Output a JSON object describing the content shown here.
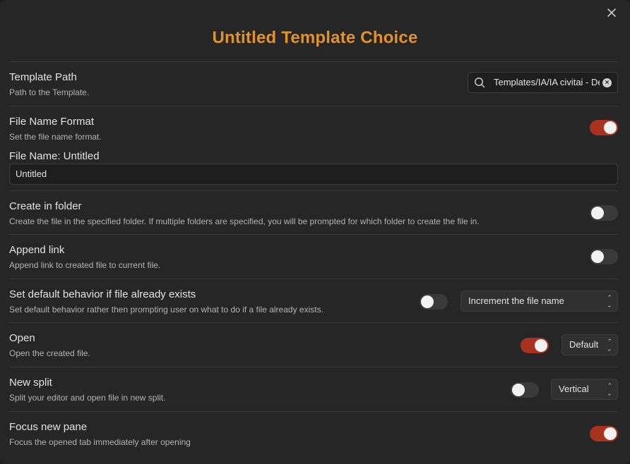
{
  "modal": {
    "title": "Untitled Template Choice",
    "close_icon": "close-icon"
  },
  "template_path": {
    "name": "Template Path",
    "desc": "Path to the Template.",
    "value": "Templates/IA/IA civitai - Default",
    "search_icon": "search-icon",
    "clear_icon": "clear-icon"
  },
  "file_name_format": {
    "name": "File Name Format",
    "desc": "Set the file name format.",
    "enabled": true,
    "label": "File Name: Untitled",
    "value": "Untitled"
  },
  "create_in_folder": {
    "name": "Create in folder",
    "desc": "Create the file in the specified folder. If multiple folders are specified, you will be prompted for which folder to create the file in.",
    "enabled": false
  },
  "append_link": {
    "name": "Append link",
    "desc": "Append link to created file to current file.",
    "enabled": false
  },
  "default_behavior": {
    "name": "Set default behavior if file already exists",
    "desc": "Set default behavior rather then prompting user on what to do if a file already exists.",
    "enabled": false,
    "selected": "Increment the file name"
  },
  "open": {
    "name": "Open",
    "desc": "Open the created file.",
    "enabled": true,
    "selected": "Default"
  },
  "new_split": {
    "name": "New split",
    "desc": "Split your editor and open file in new split.",
    "enabled": false,
    "selected": "Vertical"
  },
  "focus_new_pane": {
    "name": "Focus new pane",
    "desc": "Focus the opened tab immediately after opening",
    "enabled": true
  },
  "colors": {
    "accent": "#e0922d",
    "toggle_on": "#a8321f",
    "background": "#262626"
  }
}
